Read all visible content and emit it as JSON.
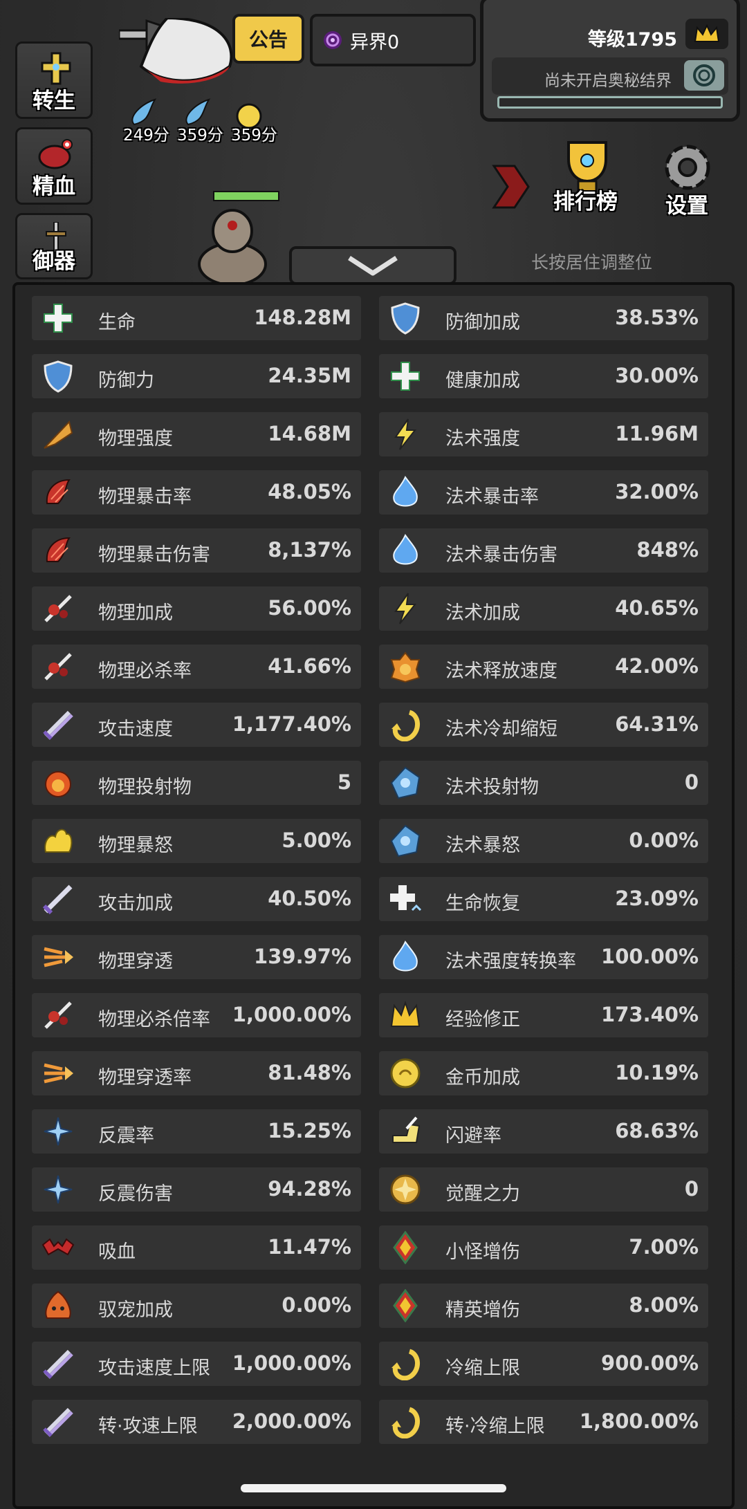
{
  "header": {
    "notice_label": "公告",
    "realm_label": "异界0",
    "level_label": "等级1795",
    "seal_label": "尚未开启奥秘结界",
    "seal_progress": 0
  },
  "side_buttons": [
    {
      "label": "转生",
      "icon": "rebirth-cross-icon"
    },
    {
      "label": "精血",
      "icon": "blood-meat-icon"
    },
    {
      "label": "御器",
      "icon": "weapon-icon"
    }
  ],
  "scores": [
    "249分",
    "359分",
    "359分"
  ],
  "right_buttons": {
    "ranking": "排行榜",
    "settings": "设置"
  },
  "hint_text": "长按居住调整位",
  "stats": [
    {
      "name": "生命",
      "value": "148.28M",
      "icon": "health-cross-icon"
    },
    {
      "name": "防御加成",
      "value": "38.53%",
      "icon": "shield-icon"
    },
    {
      "name": "防御力",
      "value": "24.35M",
      "icon": "shield-icon"
    },
    {
      "name": "健康加成",
      "value": "30.00%",
      "icon": "health-cross-icon"
    },
    {
      "name": "物理强度",
      "value": "14.68M",
      "icon": "arrowhead-icon"
    },
    {
      "name": "法术强度",
      "value": "11.96M",
      "icon": "lightning-icon"
    },
    {
      "name": "物理暴击率",
      "value": "48.05%",
      "icon": "claw-crit-icon"
    },
    {
      "name": "法术暴击率",
      "value": "32.00%",
      "icon": "blue-flame-icon"
    },
    {
      "name": "物理暴击伤害",
      "value": "8,137%",
      "icon": "claw-crit-icon"
    },
    {
      "name": "法术暴击伤害",
      "value": "848%",
      "icon": "blue-flame-icon"
    },
    {
      "name": "物理加成",
      "value": "56.00%",
      "icon": "slash-blood-icon"
    },
    {
      "name": "法术加成",
      "value": "40.65%",
      "icon": "lightning-icon"
    },
    {
      "name": "物理必杀率",
      "value": "41.66%",
      "icon": "slash-blood-icon"
    },
    {
      "name": "法术释放速度",
      "value": "42.00%",
      "icon": "fire-flower-icon"
    },
    {
      "name": "攻击速度",
      "value": "1,177.40%",
      "icon": "double-sword-icon"
    },
    {
      "name": "法术冷却缩短",
      "value": "64.31%",
      "icon": "cooldown-swirl-icon"
    },
    {
      "name": "物理投射物",
      "value": "5",
      "icon": "fireball-icon"
    },
    {
      "name": "法术投射物",
      "value": "0",
      "icon": "blue-orb-icon"
    },
    {
      "name": "物理暴怒",
      "value": "5.00%",
      "icon": "yellow-flame-icon"
    },
    {
      "name": "法术暴怒",
      "value": "0.00%",
      "icon": "blue-orb-icon"
    },
    {
      "name": "攻击加成",
      "value": "40.50%",
      "icon": "sword-icon"
    },
    {
      "name": "生命恢复",
      "value": "23.09%",
      "icon": "health-regen-icon"
    },
    {
      "name": "物理穿透",
      "value": "139.97%",
      "icon": "pierce-arrows-icon"
    },
    {
      "name": "法术强度转换率",
      "value": "100.00%",
      "icon": "blue-flame-icon"
    },
    {
      "name": "物理必杀倍率",
      "value": "1,000.00%",
      "icon": "slash-blood-icon"
    },
    {
      "name": "经验修正",
      "value": "173.40%",
      "icon": "crown-icon"
    },
    {
      "name": "物理穿透率",
      "value": "81.48%",
      "icon": "pierce-arrows-icon"
    },
    {
      "name": "金币加成",
      "value": "10.19%",
      "icon": "gold-coin-icon"
    },
    {
      "name": "反震率",
      "value": "15.25%",
      "icon": "ice-shards-icon"
    },
    {
      "name": "闪避率",
      "value": "68.63%",
      "icon": "winged-boot-icon"
    },
    {
      "name": "反震伤害",
      "value": "94.28%",
      "icon": "ice-shards-icon"
    },
    {
      "name": "觉醒之力",
      "value": "0",
      "icon": "awaken-sun-icon"
    },
    {
      "name": "吸血",
      "value": "11.47%",
      "icon": "bat-icon"
    },
    {
      "name": "小怪增伤",
      "value": "7.00%",
      "icon": "red-gem-icon"
    },
    {
      "name": "驭宠加成",
      "value": "0.00%",
      "icon": "pet-slime-icon"
    },
    {
      "name": "精英增伤",
      "value": "8.00%",
      "icon": "red-gem-icon"
    },
    {
      "name": "攻击速度上限",
      "value": "1,000.00%",
      "icon": "double-sword-icon"
    },
    {
      "name": "冷缩上限",
      "value": "900.00%",
      "icon": "cooldown-swirl-icon"
    },
    {
      "name": "转·攻速上限",
      "value": "2,000.00%",
      "icon": "double-sword-icon"
    },
    {
      "name": "转·冷缩上限",
      "value": "1,800.00%",
      "icon": "cooldown-swirl-icon"
    }
  ]
}
